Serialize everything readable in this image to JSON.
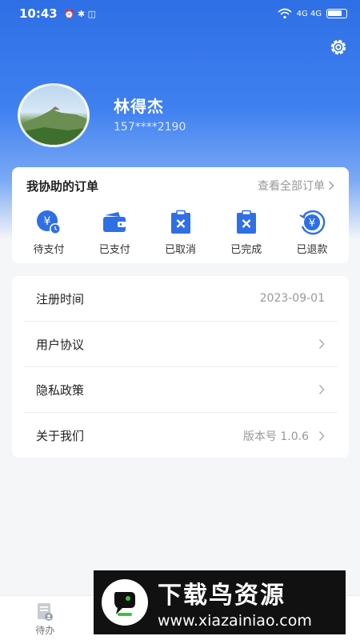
{
  "status_bar": {
    "time": "10:43",
    "left_icons": "⏰ ✱ ◫",
    "signal_labels": "4G  4G",
    "battery_icon": "battery-icon"
  },
  "settings": {
    "icon": "gear-icon"
  },
  "profile": {
    "name": "林得杰",
    "phone": "157****2190"
  },
  "orders": {
    "title": "我协助的订单",
    "view_all": "查看全部订单",
    "items": [
      {
        "label": "待支付",
        "icon": "yuan-clock-icon"
      },
      {
        "label": "已支付",
        "icon": "wallet-icon"
      },
      {
        "label": "已取消",
        "icon": "clipboard-x-icon"
      },
      {
        "label": "已完成",
        "icon": "clipboard-x-icon"
      },
      {
        "label": "已退款",
        "icon": "yuan-refund-icon"
      }
    ]
  },
  "menu": [
    {
      "label": "注册时间",
      "value": "2023-09-01"
    },
    {
      "label": "用户协议",
      "value": ""
    },
    {
      "label": "隐私政策",
      "value": ""
    },
    {
      "label": "关于我们",
      "value": "版本号 1.0.6"
    }
  ],
  "tabbar": {
    "items": [
      {
        "label": "待办",
        "active": false
      }
    ]
  },
  "watermark": {
    "title": "下载鸟资源",
    "url": "www.xiazainiao.com"
  },
  "colors": {
    "primary": "#2f6fe6",
    "background": "#f5f6f8"
  }
}
